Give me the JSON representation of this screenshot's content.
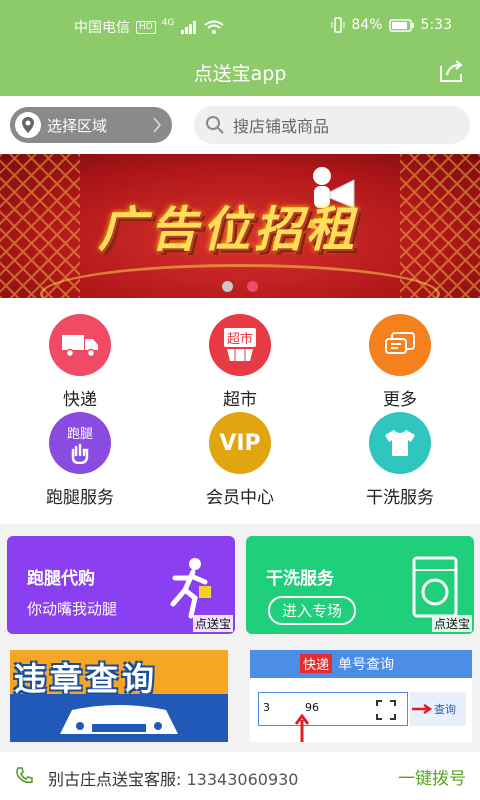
{
  "status_bar": {
    "carrier": "中国电信",
    "hd": "HD",
    "net": "4G",
    "battery": "84%",
    "time": "5:33"
  },
  "header": {
    "title": "点送宝app"
  },
  "search_row": {
    "region_label": "选择区域",
    "search_placeholder": "搜店铺或商品"
  },
  "banner": {
    "headline": "广告位招租",
    "active_dot": 2,
    "dot_count": 2
  },
  "services": [
    {
      "label": "快递",
      "icon": "truck-icon",
      "color": "#f04a64"
    },
    {
      "label": "超市",
      "icon": "supermarket-icon",
      "icon_text": "超市",
      "color": "#e83a44"
    },
    {
      "label": "更多",
      "icon": "chat-icon",
      "color": "#f4801e"
    },
    {
      "label": "跑腿服务",
      "icon": "hand-icon",
      "icon_text": "跑腿",
      "color": "#8a4be0"
    },
    {
      "label": "会员中心",
      "icon": "vip-icon",
      "icon_text": "VIP",
      "color": "#e0a50f"
    },
    {
      "label": "干洗服务",
      "icon": "tshirt-icon",
      "color": "#2fc6c0"
    }
  ],
  "promos": {
    "errand": {
      "title": "跑腿代购",
      "subtitle": "你动嘴我动腿",
      "brand": "点送宝",
      "color": "#8a3ff0"
    },
    "laundry": {
      "title": "干洗服务",
      "button": "进入专场",
      "brand": "点送宝",
      "color": "#1fcf7a"
    },
    "violation": {
      "title": "违章查询",
      "color": "#f5a623"
    },
    "tracking": {
      "tag": "快递",
      "title": "单号查询",
      "input_value": "3          96",
      "query_button": "查询"
    }
  },
  "footer": {
    "service_label": "别古庄点送宝客服:",
    "phone": "13343060930",
    "call_button": "一键拨号"
  }
}
